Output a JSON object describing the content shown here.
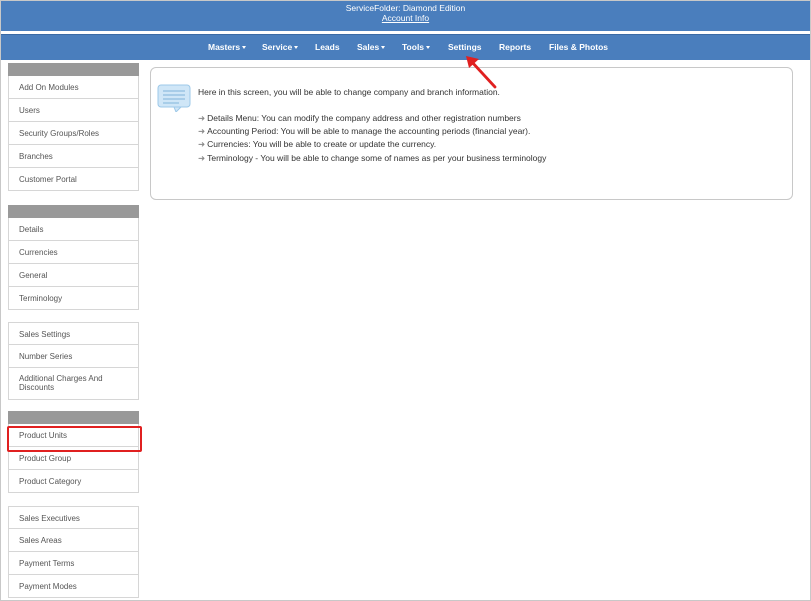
{
  "header": {
    "title": "ServiceFolder: Diamond Edition",
    "account_link": "Account Info"
  },
  "nav": [
    {
      "label": "Masters",
      "caret": true
    },
    {
      "label": "Service",
      "caret": true
    },
    {
      "label": "Leads",
      "caret": false
    },
    {
      "label": "Sales",
      "caret": true
    },
    {
      "label": "Tools",
      "caret": true
    },
    {
      "label": "Settings",
      "caret": false
    },
    {
      "label": "Reports",
      "caret": false
    },
    {
      "label": "Files & Photos",
      "caret": false
    }
  ],
  "sidebar": {
    "group1": [
      "Add On Modules",
      "Users",
      "Security Groups/Roles",
      "Branches",
      "Customer Portal"
    ],
    "group2": [
      "Details",
      "Currencies",
      "General",
      "Terminology"
    ],
    "group3": [
      "Sales Settings",
      "Number Series",
      "Additional Charges And Discounts"
    ],
    "group4": [
      "Product Units",
      "Product Group",
      "Product Category"
    ],
    "group5": [
      "Sales Executives",
      "Sales Areas",
      "Payment Terms",
      "Payment Modes"
    ]
  },
  "info": {
    "intro": "Here in this screen, you will be able to change company and branch information.",
    "bullets": [
      "Details Menu: You can modify the company address and other registration numbers",
      "Accounting Period: You will be able to manage the accounting periods (financial year).",
      "Currencies: You will be able to create or update the currency.",
      "Terminology - You will be able to change some of names as per your business terminology"
    ]
  },
  "icons": {
    "info_bubble": "chat-bubble-icon",
    "bullet": "arrow-right-icon",
    "annotation": "red-arrow-icon"
  },
  "colors": {
    "brand_blue": "#4a7ebd",
    "highlight": "#e02020",
    "group_header": "#999999"
  }
}
